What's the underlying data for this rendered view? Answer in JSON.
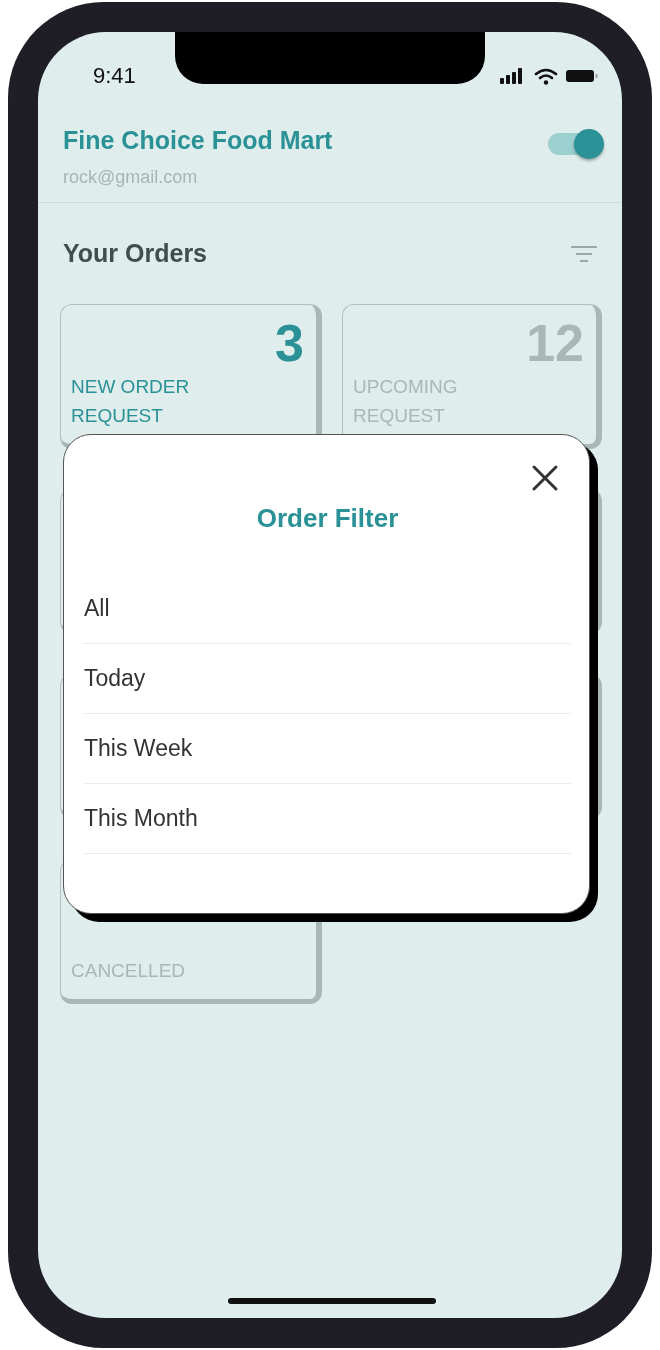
{
  "status_bar": {
    "time": "9:41"
  },
  "header": {
    "store_name": "Fine Choice Food Mart",
    "email": "rock@gmail.com",
    "toggle": {
      "on": true
    }
  },
  "orders": {
    "title": "Your Orders",
    "cards": [
      {
        "number": "3",
        "label": "NEW ORDER REQUEST",
        "selected": true
      },
      {
        "number": "12",
        "label": "UPCOMING REQUEST",
        "selected": false
      },
      {
        "label": "CANCELLED",
        "selected": false
      }
    ]
  },
  "order_filter": {
    "title": "Order Filter",
    "options": [
      "All",
      "Today",
      "This Week",
      "This Month"
    ]
  }
}
